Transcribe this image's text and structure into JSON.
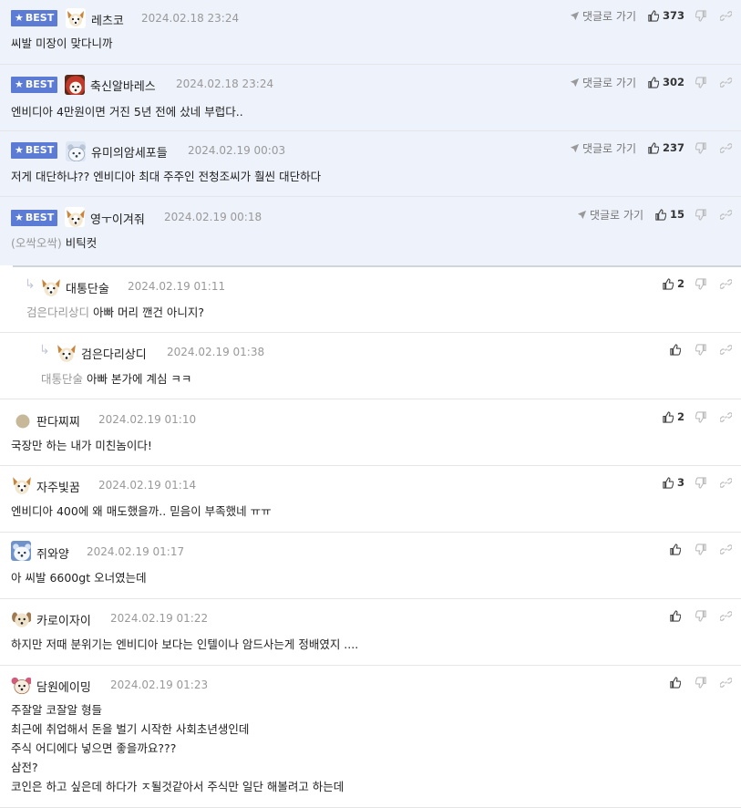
{
  "labels": {
    "best": "BEST",
    "goto": "댓글로 가기"
  },
  "colors": {
    "best_badge": "#5b7bd5",
    "best_row_bg": "#eef2fb",
    "mention": "#999999"
  },
  "comments": [
    {
      "nick": "레츠코",
      "date": "2024.02.18 23:24",
      "text": "씨발 미장이 맞다니까",
      "mention": "",
      "likes": "373",
      "best": true,
      "avatar": "dog-avatar"
    },
    {
      "nick": "축신알바레스",
      "date": "2024.02.18 23:24",
      "text": "엔비디아 4만원이면 거진 5년 전에 샀네 부럽다..",
      "mention": "",
      "likes": "302",
      "best": true,
      "avatar": "dog-avatar"
    },
    {
      "nick": "유미의암세포들",
      "date": "2024.02.19 00:03",
      "text": "저게 대단하냐?? 엔비디아 최대 주주인 전청조씨가 훨씬 대단하다",
      "mention": "",
      "likes": "237",
      "best": true,
      "avatar": "bear-avatar"
    },
    {
      "nick": "영ㅜ이겨줘",
      "date": "2024.02.19 00:18",
      "text": "비틱컷",
      "mention": "(오싹오싹)",
      "likes": "15",
      "best": true,
      "avatar": "dog-avatar"
    },
    {
      "nick": "대통단술",
      "date": "2024.02.19 01:11",
      "text": "아빠 머리 깬건 아니지?",
      "mention": "검은다리상디",
      "likes": "2",
      "best": false,
      "avatar": "dog-avatar"
    },
    {
      "nick": "검은다리상디",
      "date": "2024.02.19 01:38",
      "text": "아빠 본가에 계심 ㅋㅋ",
      "mention": "대통단술",
      "likes": "",
      "best": false,
      "avatar": "dog-avatar"
    },
    {
      "nick": "판다찌찌",
      "date": "2024.02.19 01:10",
      "text": "국장만 하는 내가 미친놈이다!",
      "mention": "",
      "likes": "2",
      "best": false,
      "avatar": "dot-avatar"
    },
    {
      "nick": "자주빛꿈",
      "date": "2024.02.19 01:14",
      "text": "엔비디아 400에 왜 매도했을까.. 믿음이 부족했네 ㅠㅠ",
      "mention": "",
      "likes": "3",
      "best": false,
      "avatar": "dog-avatar"
    },
    {
      "nick": "쥐와양",
      "date": "2024.02.19 01:17",
      "text": "아 씨발 6600gt 오너였는데",
      "mention": "",
      "likes": "",
      "best": false,
      "avatar": "bear-avatar"
    },
    {
      "nick": "카로이자이",
      "date": "2024.02.19 01:22",
      "text": "하지만 저때 분위기는 엔비디아 보다는 인텔이나 암드사는게 정배였지 ....",
      "mention": "",
      "likes": "",
      "best": false,
      "avatar": "dog-avatar"
    },
    {
      "nick": "담원에이밍",
      "date": "2024.02.19 01:23",
      "text": "",
      "mention": "",
      "likes": "",
      "best": false,
      "avatar": "dog-avatar",
      "lines": [
        "주잘알 코잘알 형들",
        "최근에 취업해서 돈을 벌기 시작한 사회초년생인데",
        "주식 어디에다 넣으면 좋을까요???",
        "삼전?",
        "코인은 하고 싶은데 하다가 ㅈ될것같아서 주식만 일단 해볼려고 하는데"
      ]
    }
  ]
}
